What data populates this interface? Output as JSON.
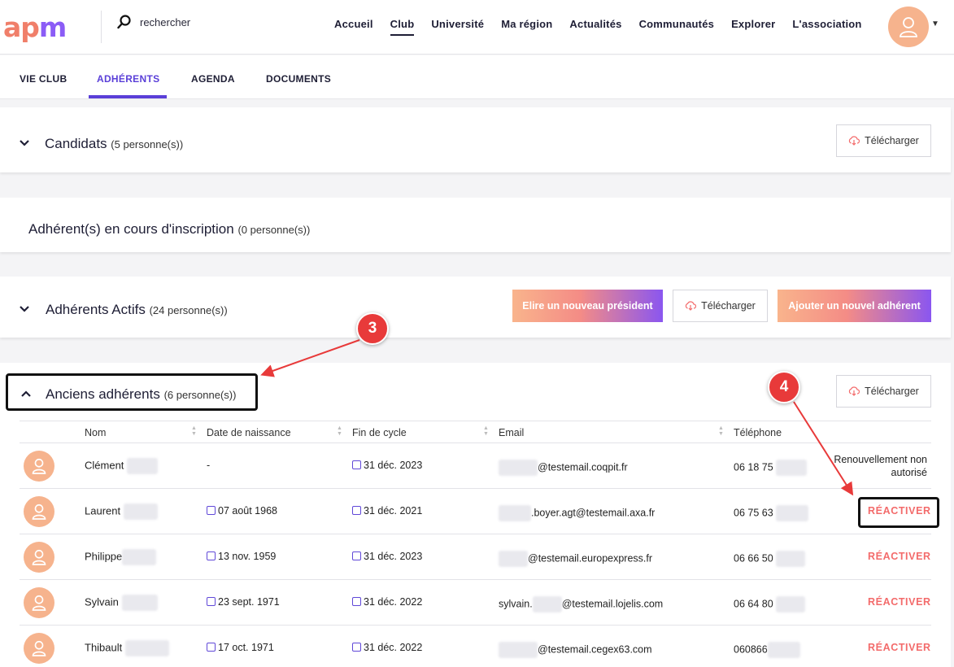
{
  "header": {
    "logo": {
      "a": "ap",
      "m": "m"
    },
    "search_placeholder": "rechercher",
    "nav": [
      "Accueil",
      "Club",
      "Université",
      "Ma région",
      "Actualités",
      "Communautés",
      "Explorer",
      "L'association"
    ],
    "active_nav": "Club"
  },
  "tabs": [
    "VIE CLUB",
    "ADHÉRENTS",
    "AGENDA",
    "DOCUMENTS"
  ],
  "active_tab": "ADHÉRENTS",
  "sections": {
    "candidats": {
      "title": "Candidats",
      "count": "(5 personne(s))",
      "download": "Télécharger"
    },
    "inscription": {
      "title": "Adhérent(s) en cours d'inscription",
      "count": "(0 personne(s))"
    },
    "actifs": {
      "title": "Adhérents Actifs",
      "count": "(24 personne(s))",
      "btn_president": "Elire un nouveau président",
      "download": "Télécharger",
      "btn_add": "Ajouter un nouvel adhérent"
    },
    "anciens": {
      "title": "Anciens adhérents",
      "count": "(6 personne(s))",
      "download": "Télécharger"
    }
  },
  "table": {
    "columns": [
      "Nom",
      "Date de naissance",
      "Fin de cycle",
      "Email",
      "Téléphone"
    ],
    "rows": [
      {
        "name": "Clément",
        "birth": "-",
        "cycle": "31 déc. 2023",
        "email": "@testemail.coqpit.fr",
        "phone": "06 18 75",
        "action": "Renouvellement non autorisé"
      },
      {
        "name": "Laurent",
        "birth": "07 août 1968",
        "cycle": "31 déc. 2021",
        "email": ".boyer.agt@testemail.axa.fr",
        "phone": "06 75 63",
        "action": "RÉACTIVER"
      },
      {
        "name": "Philippe",
        "birth": "13 nov. 1959",
        "cycle": "31 déc. 2023",
        "email": "@testemail.europexpress.fr",
        "phone": "06 66 50",
        "action": "RÉACTIVER"
      },
      {
        "name": "Sylvain",
        "birth": "23 sept. 1971",
        "cycle": "31 déc. 2022",
        "email_prefix": "sylvain.",
        "email": "@testemail.lojelis.com",
        "phone": "06 64 80",
        "action": "RÉACTIVER"
      },
      {
        "name": "Thibault",
        "birth": "17 oct. 1971",
        "cycle": "31 déc. 2022",
        "email": "@testemail.cegex63.com",
        "phone": "060866",
        "action": "RÉACTIVER"
      }
    ]
  },
  "annotations": {
    "step3": "3",
    "step4": "4"
  },
  "colors": {
    "accent": "#5a3fd8",
    "avatar": "#f6b38d",
    "reactivate": "#f36b6b",
    "annotation": "#e83a3a"
  },
  "icons": [
    "search-icon",
    "user-icon",
    "chevron-down-icon",
    "chevron-up-icon",
    "cloud-download-icon",
    "calendar-icon",
    "sort-icon"
  ]
}
